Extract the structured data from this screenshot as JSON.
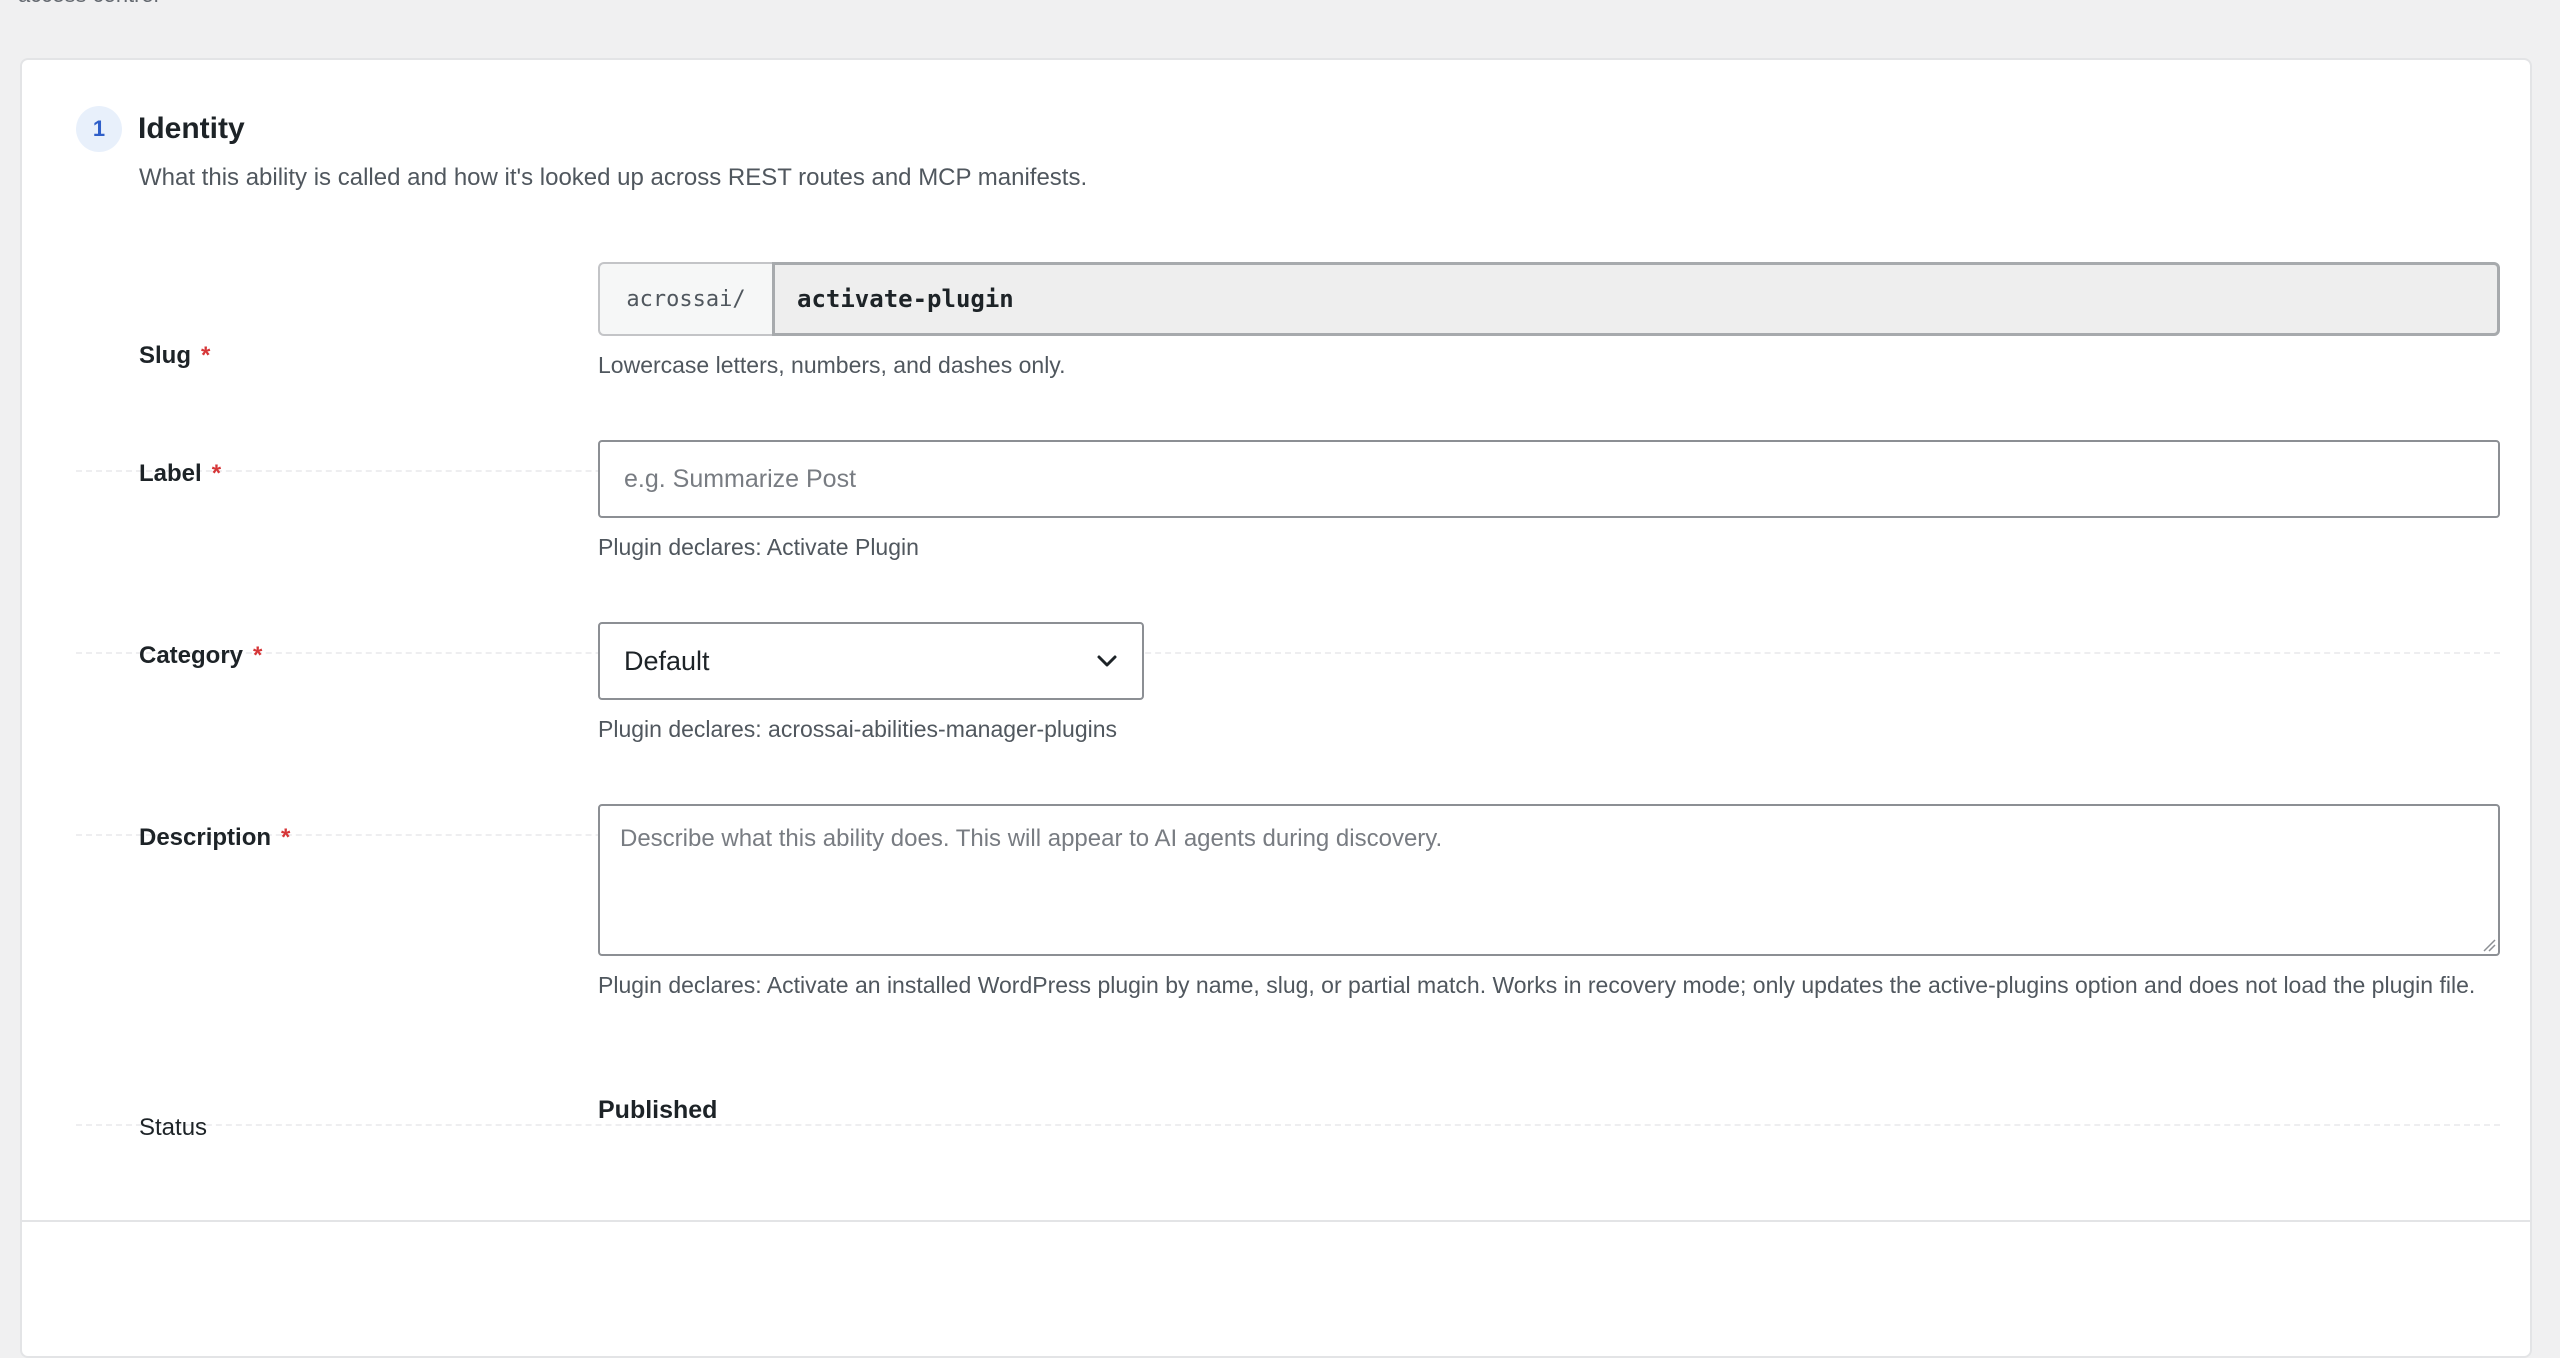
{
  "breadcrumb": {
    "text": "access control"
  },
  "section": {
    "step": "1",
    "title": "Identity",
    "description": "What this ability is called and how it's looked up across REST routes and MCP manifests."
  },
  "fields": {
    "slug": {
      "label": "Slug",
      "required_mark": "*",
      "prefix": "acrossai/",
      "value": "activate-plugin",
      "help": "Lowercase letters, numbers, and dashes only."
    },
    "label": {
      "label": "Label",
      "required_mark": "*",
      "value": "",
      "placeholder": "e.g. Summarize Post",
      "help": "Plugin declares: Activate Plugin"
    },
    "category": {
      "label": "Category",
      "required_mark": "*",
      "selected": "Default",
      "help": "Plugin declares: acrossai-abilities-manager-plugins"
    },
    "description": {
      "label": "Description",
      "required_mark": "*",
      "value": "",
      "placeholder": "Describe what this ability does. This will appear to AI agents during discovery.",
      "help": "Plugin declares: Activate an installed WordPress plugin by name, slug, or partial match. Works in recovery mode; only updates the active-plugins option and does not load the plugin file."
    },
    "status": {
      "label": "Status",
      "value": "Published"
    }
  },
  "colors": {
    "accent": "#2f5fc9",
    "required": "#d63638",
    "page_bg": "#f0f0f1",
    "card_bg": "#ffffff"
  },
  "icons": {
    "select_arrow": "chevron-down-icon",
    "textarea_resize": "resize-grip-icon"
  }
}
